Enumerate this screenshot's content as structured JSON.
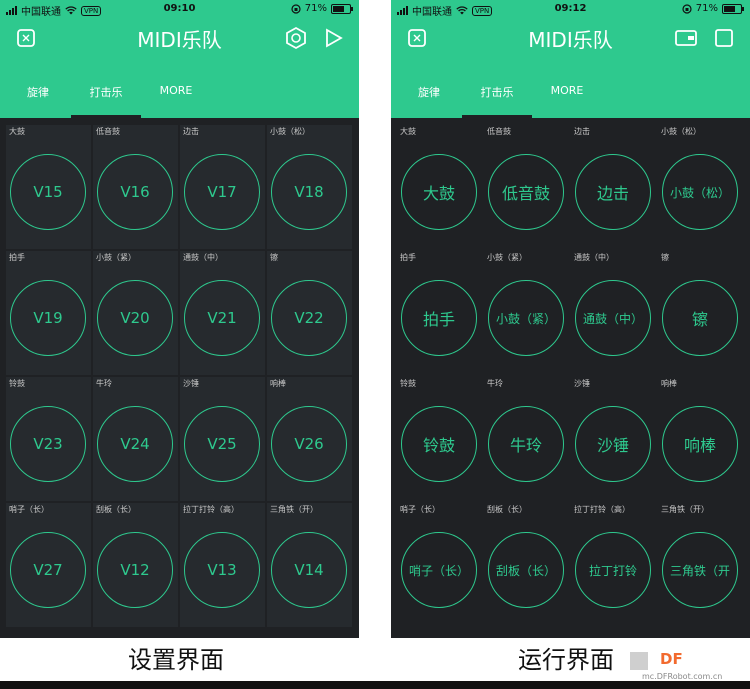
{
  "status": {
    "carrier": "中国联通",
    "vpn": "VPN",
    "battery": "71%",
    "battery_level": 0.71
  },
  "screens": [
    {
      "time": "09:10",
      "title": "MIDI乐队",
      "tabs": [
        "旋律",
        "打击乐",
        "MORE"
      ],
      "active_tab": 1,
      "pads": [
        {
          "label": "大鼓",
          "value": "V15"
        },
        {
          "label": "低音鼓",
          "value": "V16"
        },
        {
          "label": "边击",
          "value": "V17"
        },
        {
          "label": "小鼓（松）",
          "value": "V18"
        },
        {
          "label": "拍手",
          "value": "V19"
        },
        {
          "label": "小鼓（紧）",
          "value": "V20"
        },
        {
          "label": "通鼓（中）",
          "value": "V21"
        },
        {
          "label": "镲",
          "value": "V22"
        },
        {
          "label": "铃鼓",
          "value": "V23"
        },
        {
          "label": "牛玲",
          "value": "V24"
        },
        {
          "label": "沙锤",
          "value": "V25"
        },
        {
          "label": "响棒",
          "value": "V26"
        },
        {
          "label": "哨子（长）",
          "value": "V27"
        },
        {
          "label": "刮板（长）",
          "value": "V12"
        },
        {
          "label": "拉丁打铃（高）",
          "value": "V13"
        },
        {
          "label": "三角铁（开）",
          "value": "V14"
        }
      ],
      "caption": "设置界面"
    },
    {
      "time": "09:12",
      "title": "MIDI乐队",
      "tabs": [
        "旋律",
        "打击乐",
        "MORE"
      ],
      "active_tab": 1,
      "pads": [
        {
          "label": "大鼓",
          "value": "大鼓"
        },
        {
          "label": "低音鼓",
          "value": "低音鼓"
        },
        {
          "label": "边击",
          "value": "边击"
        },
        {
          "label": "小鼓（松）",
          "value": "小鼓（松）"
        },
        {
          "label": "拍手",
          "value": "拍手"
        },
        {
          "label": "小鼓（紧）",
          "value": "小鼓（紧）"
        },
        {
          "label": "通鼓（中）",
          "value": "通鼓（中）"
        },
        {
          "label": "镲",
          "value": "镲"
        },
        {
          "label": "铃鼓",
          "value": "铃鼓"
        },
        {
          "label": "牛玲",
          "value": "牛玲"
        },
        {
          "label": "沙锤",
          "value": "沙锤"
        },
        {
          "label": "响棒",
          "value": "响棒"
        },
        {
          "label": "哨子（长）",
          "value": "哨子（长）"
        },
        {
          "label": "刮板（长）",
          "value": "刮板（长）"
        },
        {
          "label": "拉丁打铃（高）",
          "value": "拉丁打铃"
        },
        {
          "label": "三角铁（开）",
          "value": "三角铁（开"
        }
      ],
      "caption": "运行界面"
    }
  ],
  "watermark": {
    "logo": "DF",
    "url": "mc.DFRobot.com.cn"
  },
  "colors": {
    "accent": "#2ec98e",
    "background": "#1f2124",
    "pad_cell": "#262a2e"
  },
  "icons": {
    "left_screen": [
      "device-icon",
      "settings-hexagon-icon",
      "play-icon"
    ],
    "right_screen": [
      "device-icon",
      "wallet-icon",
      "stop-icon"
    ]
  }
}
